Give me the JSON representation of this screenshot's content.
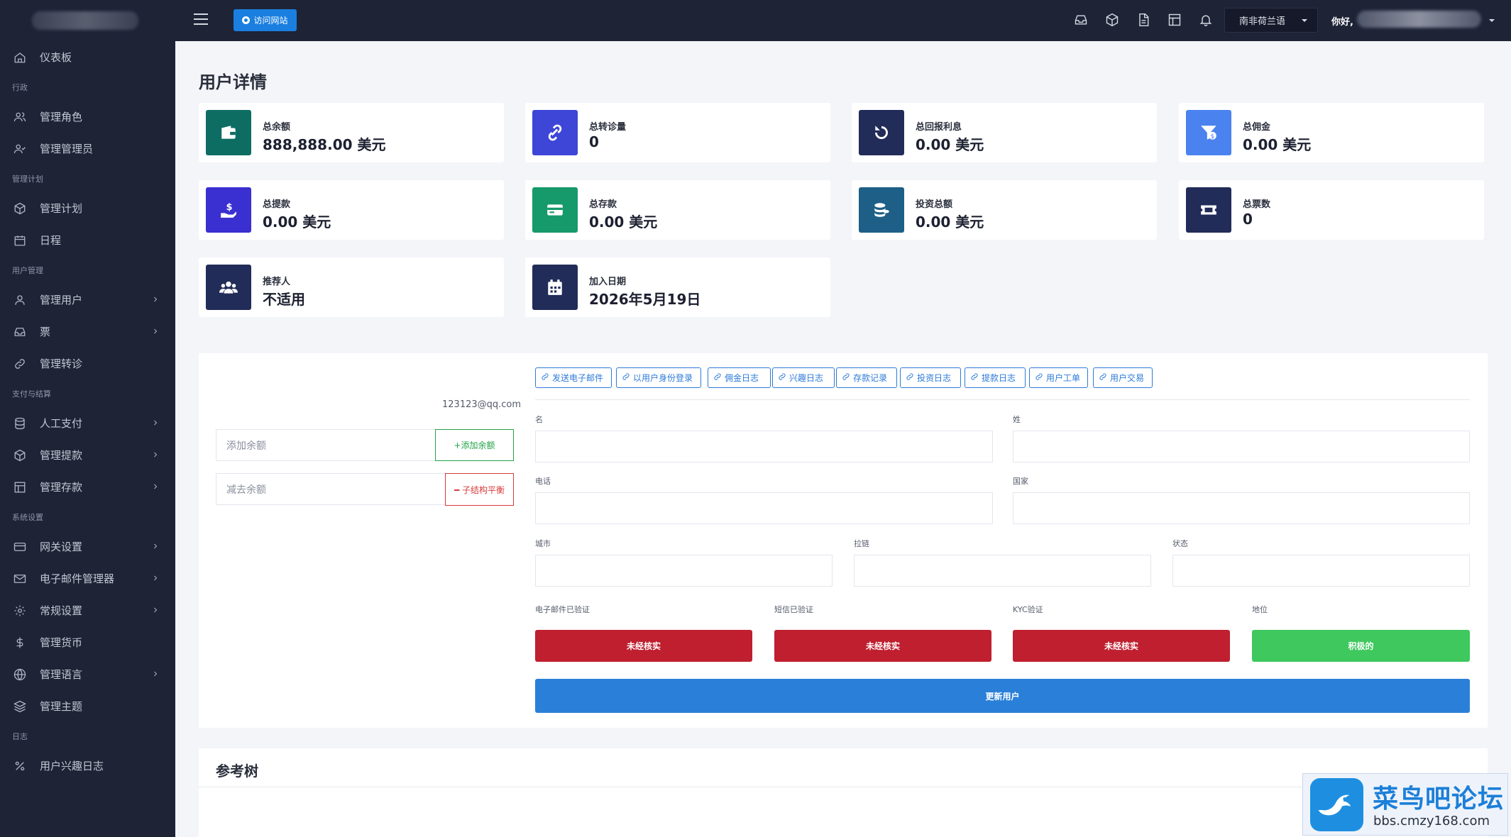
{
  "sidebar": {
    "items": [
      {
        "type": "item",
        "label": "仪表板",
        "icon": "home-icon",
        "chevron": false
      },
      {
        "type": "section",
        "label": "行政"
      },
      {
        "type": "item",
        "label": "管理角色",
        "icon": "users-icon",
        "chevron": false
      },
      {
        "type": "item",
        "label": "管理管理员",
        "icon": "user-check-icon",
        "chevron": false
      },
      {
        "type": "section",
        "label": "管理计划"
      },
      {
        "type": "item",
        "label": "管理计划",
        "icon": "package-icon",
        "chevron": false
      },
      {
        "type": "item",
        "label": "日程",
        "icon": "calendar-icon",
        "chevron": false
      },
      {
        "type": "section",
        "label": "用户管理"
      },
      {
        "type": "item",
        "label": "管理用户",
        "icon": "user-icon",
        "chevron": true
      },
      {
        "type": "item",
        "label": "票",
        "icon": "inbox-icon",
        "chevron": true
      },
      {
        "type": "item",
        "label": "管理转诊",
        "icon": "link-icon",
        "chevron": false
      },
      {
        "type": "section",
        "label": "支付与结算"
      },
      {
        "type": "item",
        "label": "人工支付",
        "icon": "database-icon",
        "chevron": true
      },
      {
        "type": "item",
        "label": "管理提款",
        "icon": "package-icon",
        "chevron": true
      },
      {
        "type": "item",
        "label": "管理存款",
        "icon": "layout-icon",
        "chevron": true
      },
      {
        "type": "section",
        "label": "系统设置"
      },
      {
        "type": "item",
        "label": "网关设置",
        "icon": "credit-card-icon",
        "chevron": true
      },
      {
        "type": "item",
        "label": "电子邮件管理器",
        "icon": "mail-icon",
        "chevron": true
      },
      {
        "type": "item",
        "label": "常规设置",
        "icon": "settings-icon",
        "chevron": true
      },
      {
        "type": "item",
        "label": "管理货币",
        "icon": "dollar-icon",
        "chevron": false
      },
      {
        "type": "item",
        "label": "管理语言",
        "icon": "globe-icon",
        "chevron": true
      },
      {
        "type": "item",
        "label": "管理主题",
        "icon": "layers-icon",
        "chevron": false
      },
      {
        "type": "section",
        "label": "日志"
      },
      {
        "type": "item",
        "label": "用户兴趣日志",
        "icon": "percent-icon",
        "chevron": false
      }
    ]
  },
  "topbar": {
    "visit_label": "访问网站",
    "language": "南非荷兰语",
    "greeting": "你好,",
    "icons": [
      "inbox-icon",
      "package-icon",
      "file-text-icon",
      "layout-icon",
      "bell-icon"
    ]
  },
  "page": {
    "title": "用户详情"
  },
  "cards": [
    {
      "label": "总余额",
      "value": "888,888.00 美元",
      "icon": "wallet-icon",
      "color": "#0e6d63"
    },
    {
      "label": "总转诊量",
      "value": "0",
      "icon": "link-icon",
      "color": "#3d46d6"
    },
    {
      "label": "总回报利息",
      "value": "0.00 美元",
      "icon": "refresh-icon",
      "color": "#222c59"
    },
    {
      "label": "总佣金",
      "value": "0.00 美元",
      "icon": "funnel-dollar-icon",
      "color": "#4a82ef"
    },
    {
      "label": "总提款",
      "value": "0.00 美元",
      "icon": "hand-dollar-icon",
      "color": "#3a2fd0"
    },
    {
      "label": "总存款",
      "value": "0.00 美元",
      "icon": "credit-card-icon",
      "color": "#16996b"
    },
    {
      "label": "投资总额",
      "value": "0.00 美元",
      "icon": "coins-icon",
      "color": "#1d5f86"
    },
    {
      "label": "总票数",
      "value": "0",
      "icon": "ticket-icon",
      "color": "#222c59"
    },
    {
      "label": "推荐人",
      "value": "不适用",
      "icon": "users-group-icon",
      "color": "#222c59"
    },
    {
      "label": "加入日期",
      "value": "2026年5月19日",
      "icon": "calendar-icon",
      "color": "#222c59"
    }
  ],
  "balance": {
    "email": "123123@qq.com",
    "add_placeholder": "添加余额",
    "add_button": "+添加余额",
    "sub_placeholder": "减去余额",
    "sub_button": "━ 子结构平衡"
  },
  "actions": [
    "发送电子邮件",
    "以用户身份登录",
    "佣金日志",
    "兴趣日志",
    "存款记录",
    "投资日志",
    "提款日志",
    "用户工单",
    "用户交易"
  ],
  "form": {
    "first_name_label": "名",
    "last_name_label": "姓",
    "phone_label": "电话",
    "country_label": "国家",
    "city_label": "城市",
    "zip_label": "拉链",
    "state_label": "状态",
    "email_verified_label": "电子邮件已验证",
    "sms_verified_label": "短信已验证",
    "kyc_label": "KYC验证",
    "status_label": "地位",
    "email_verified_value": "未经核实",
    "sms_verified_value": "未经核实",
    "kyc_value": "未经核实",
    "status_value": "积极的",
    "update_button": "更新用户"
  },
  "colors": {
    "unverified": "#bf1f2f",
    "active": "#3ec85e",
    "primary": "#2a80d8"
  },
  "ref_tree": {
    "title": "参考树"
  },
  "watermark": {
    "title": "菜鸟吧论坛",
    "url": "bbs.cmzy168.com"
  }
}
